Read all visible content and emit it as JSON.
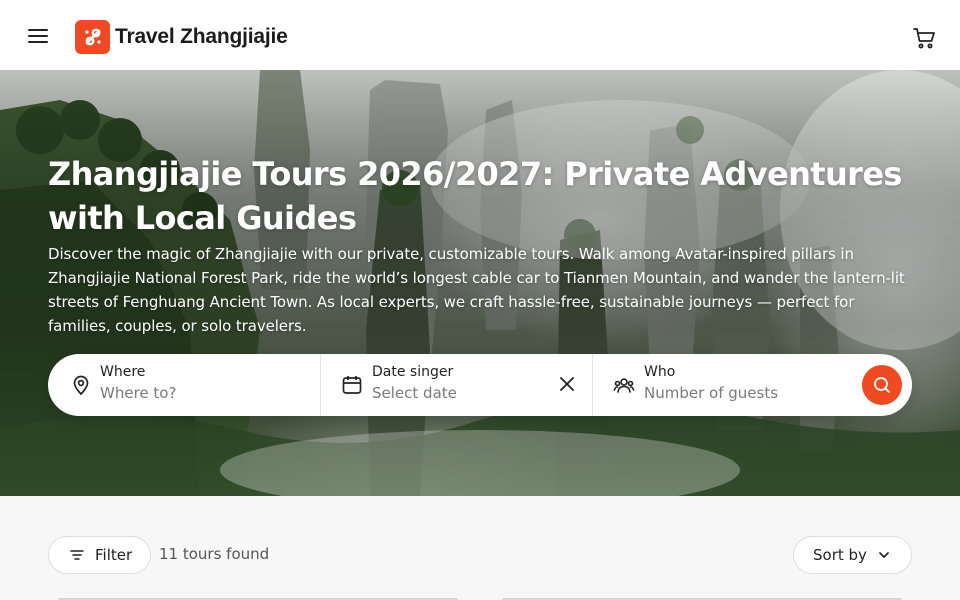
{
  "header": {
    "brand_name": "Travel Zhangjiajie",
    "menu_icon": "hamburger-menu-icon",
    "cart_icon": "shopping-cart-icon"
  },
  "hero": {
    "title": "Zhangjiajie Tours 2026/2027: Private Adventures with Local Guides",
    "description": "Discover the magic of Zhangjiajie with our private, customizable tours. Walk among Avatar-inspired pillars in Zhangjiajie National Forest Park, ride the world’s longest cable car to Tianmen Mountain, and wander the lantern-lit streets of Fenghuang Ancient Town. As local experts, we craft hassle-free, sustainable journeys — perfect for families, couples, or solo travelers."
  },
  "search": {
    "where_label": "Where",
    "where_placeholder": "Where to?",
    "date_label": "Date singer",
    "date_placeholder": "Select date",
    "who_label": "Who",
    "who_placeholder": "Number of guests"
  },
  "results": {
    "filter_label": "Filter",
    "count_text": "11 tours found",
    "sort_label": "Sort by"
  },
  "colors": {
    "accent": "#f04a23",
    "brand_logo": "#ef4a25"
  }
}
